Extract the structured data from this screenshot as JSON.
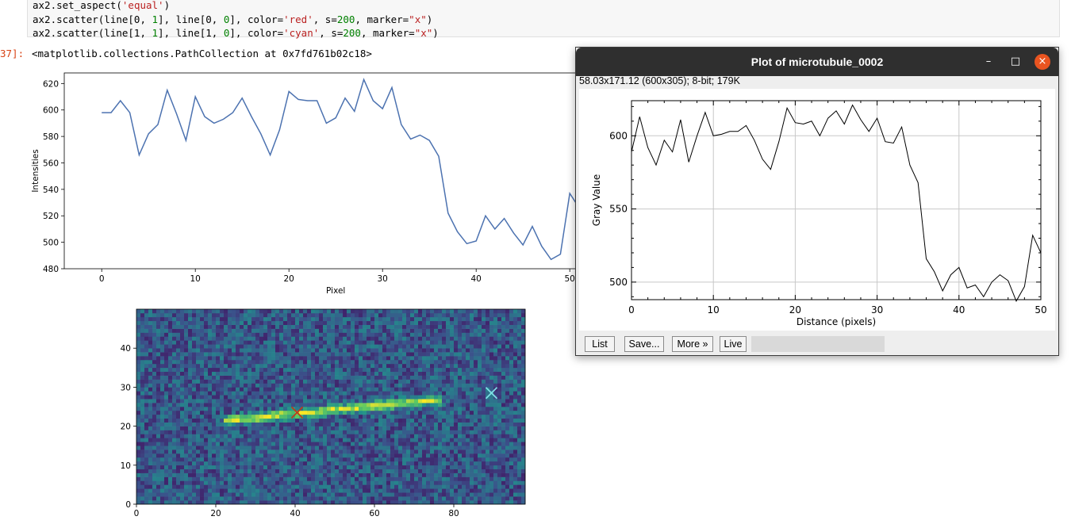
{
  "notebook": {
    "code_lines": [
      {
        "pre": "ax2.",
        "fn": "set_aspect(",
        "str": "'equal'",
        "post": ")"
      },
      {
        "a": "ax2.scatter(line[0, ",
        "n1": "1",
        "b": "], line[0, ",
        "n2": "0",
        "c": "], color=",
        "s1": "'red'",
        "d": ", s=",
        "n3": "200",
        "e": ", marker=",
        "s2": "\"x\"",
        "f": ")"
      },
      {
        "a": "ax2.scatter(line[1, ",
        "n1": "1",
        "b": "], line[1, ",
        "n2": "0",
        "c": "], color=",
        "s1": "'cyan'",
        "d": ", s=",
        "n3": "200",
        "e": ", marker=",
        "s2": "\"x\"",
        "f": ")"
      }
    ],
    "prompt": "37]:",
    "output_text": "<matplotlib.collections.PathCollection at 0x7fd761b02c18>"
  },
  "chart_data": [
    {
      "type": "line",
      "xlabel": "Pixel",
      "ylabel": "Intensities",
      "xlim": [
        -4,
        51
      ],
      "ylim": [
        480,
        628
      ],
      "xticks": [
        "0",
        "10",
        "20",
        "30",
        "40",
        "50"
      ],
      "yticks": [
        "480",
        "500",
        "520",
        "540",
        "560",
        "580",
        "600",
        "620"
      ],
      "color": "#4c72b0",
      "x": [
        0,
        1,
        2,
        3,
        4,
        5,
        6,
        7,
        8,
        9,
        10,
        11,
        12,
        13,
        14,
        15,
        16,
        17,
        18,
        19,
        20,
        21,
        22,
        23,
        24,
        25,
        26,
        27,
        28,
        29,
        30,
        31,
        32,
        33,
        34,
        35,
        36,
        37,
        38,
        39,
        40,
        41,
        42,
        43,
        44,
        45,
        46,
        47,
        48,
        49,
        50,
        51
      ],
      "y": [
        598,
        598,
        607,
        598,
        566,
        582,
        589,
        615,
        597,
        577,
        610,
        595,
        590,
        593,
        598,
        609,
        595,
        582,
        566,
        585,
        614,
        608,
        607,
        607,
        590,
        594,
        609,
        599,
        623,
        607,
        601,
        617,
        589,
        578,
        581,
        577,
        565,
        522,
        508,
        499,
        501,
        520,
        510,
        518,
        507,
        498,
        512,
        497,
        487,
        491,
        537,
        526
      ]
    },
    {
      "type": "heatmap",
      "xticks": [
        "0",
        "20",
        "40",
        "60",
        "80"
      ],
      "yticks": [
        "0",
        "10",
        "20",
        "30",
        "40"
      ],
      "xlim": [
        0,
        98
      ],
      "ylim": [
        0,
        50
      ],
      "colormap": "viridis",
      "markers": [
        {
          "x": 40.5,
          "y": 23.5,
          "color": "#c0391b",
          "marker": "x"
        },
        {
          "x": 89.5,
          "y": 28.5,
          "color": "#7fdfe6",
          "marker": "x"
        }
      ]
    },
    {
      "type": "line",
      "xlabel": "Distance (pixels)",
      "ylabel": "Gray Value",
      "xlim": [
        0,
        50
      ],
      "ylim": [
        488,
        624
      ],
      "xticks": [
        "0",
        "10",
        "20",
        "30",
        "40",
        "50"
      ],
      "yticks": [
        "500",
        "550",
        "600"
      ],
      "color": "#000000",
      "x": [
        0,
        1,
        2,
        3,
        4,
        5,
        6,
        7,
        8,
        9,
        10,
        11,
        12,
        13,
        14,
        15,
        16,
        17,
        18,
        19,
        20,
        21,
        22,
        23,
        24,
        25,
        26,
        27,
        28,
        29,
        30,
        31,
        32,
        33,
        34,
        35,
        36,
        37,
        38,
        39,
        40,
        41,
        42,
        43,
        44,
        45,
        46,
        47,
        48,
        49,
        50
      ],
      "y": [
        589,
        613,
        592,
        580,
        597,
        589,
        611,
        582,
        600,
        616,
        600,
        601,
        603,
        603,
        607,
        597,
        584,
        577,
        596,
        619,
        609,
        608,
        610,
        600,
        612,
        617,
        608,
        621,
        611,
        603,
        612,
        596,
        595,
        606,
        580,
        568,
        516,
        507,
        494,
        505,
        510,
        496,
        498,
        490,
        500,
        505,
        501,
        487,
        497,
        532,
        520
      ]
    }
  ],
  "imagej": {
    "title": "Plot of microtubule_0002",
    "info": "58.03x171.12   (600x305); 8-bit; 179K",
    "buttons": {
      "list": "List",
      "save": "Save...",
      "more": "More »",
      "live": "Live"
    },
    "window_controls": {
      "minimize": "–",
      "maximize": "□",
      "close": "×"
    },
    "close_color": "#e95420"
  }
}
